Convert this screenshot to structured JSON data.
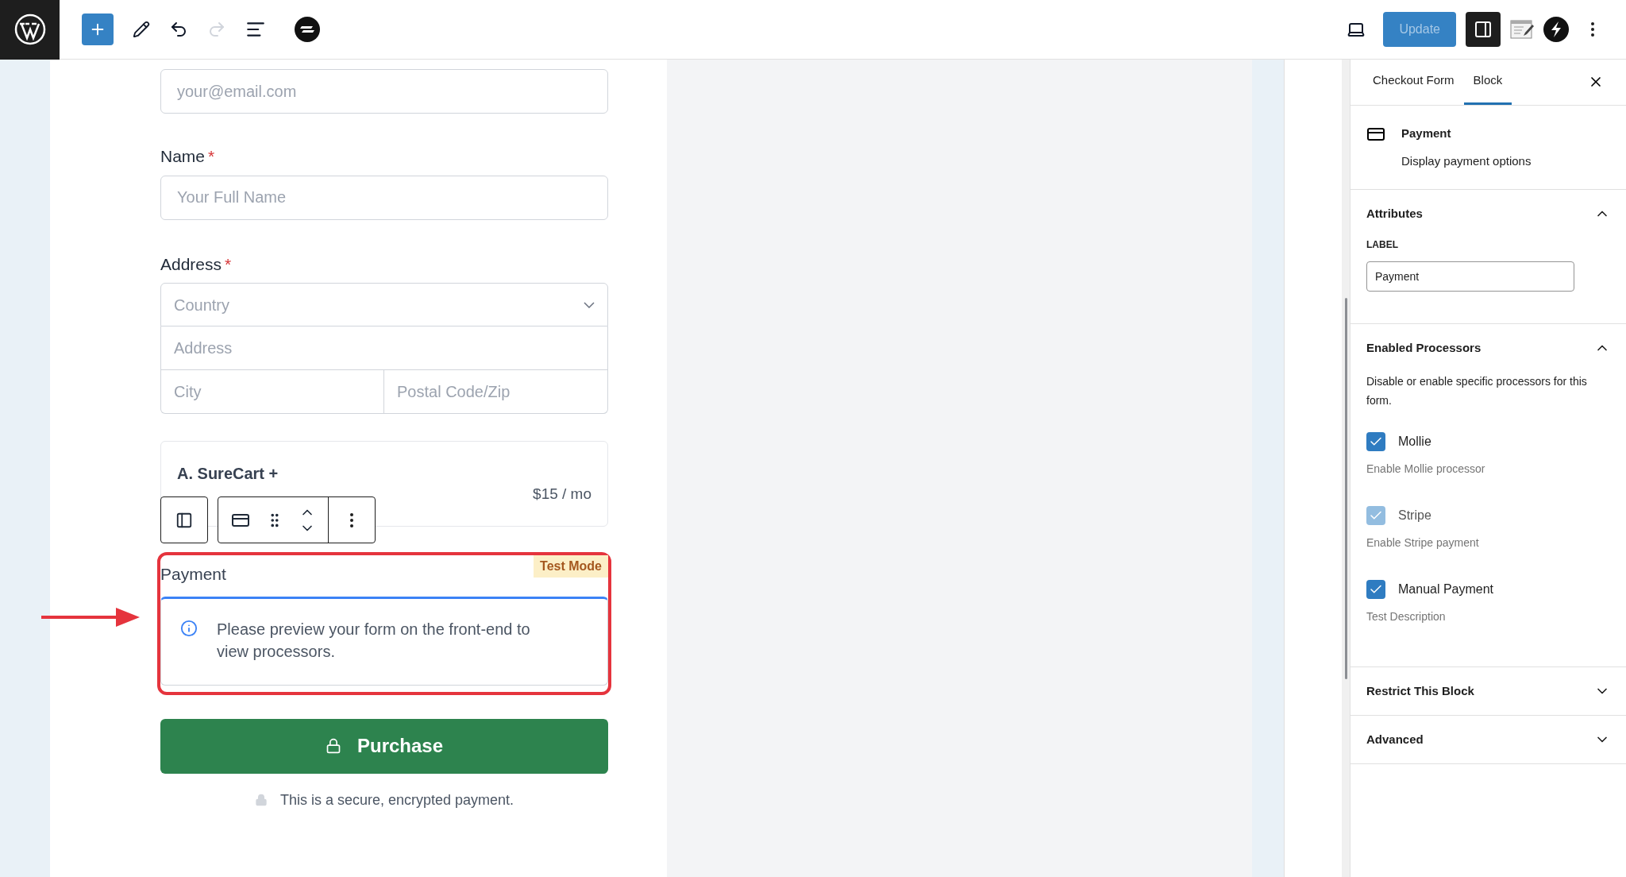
{
  "top_bar": {
    "left_tools": [
      {
        "kind": "add",
        "disabled": false
      },
      {
        "kind": "pencil",
        "disabled": false
      },
      {
        "kind": "undo",
        "disabled": false
      },
      {
        "kind": "redo",
        "disabled": true
      },
      {
        "kind": "list",
        "disabled": false
      },
      {
        "kind": "brand",
        "disabled": false
      }
    ],
    "update_button": {
      "label": "Update",
      "disabled": true
    },
    "right_tools": [
      {
        "kind": "laptop",
        "selected": false
      },
      {
        "kind": "sidebar",
        "selected": true
      },
      {
        "kind": "notepad",
        "selected": false
      },
      {
        "kind": "bolt",
        "selected": false
      },
      {
        "kind": "more",
        "selected": false
      }
    ]
  },
  "form": {
    "email": {
      "placeholder": "your@email.com"
    },
    "name": {
      "label": "Name",
      "required_mark": "*",
      "placeholder": "Your Full Name"
    },
    "address": {
      "label": "Address",
      "required_mark": "*",
      "country": "Country",
      "address_placeholder": "Address",
      "city_placeholder": "City",
      "postal_placeholder": "Postal Code/Zip"
    },
    "product": {
      "name": "A. SureCart +",
      "price": "$15 / mo"
    },
    "payment": {
      "label": "Payment",
      "badge": "Test Mode",
      "notice": "Please preview your form on the front-end to view processors."
    },
    "purchase_button": "Purchase",
    "secure_note": "This is a secure, encrypted payment."
  },
  "sidebar": {
    "tabs": [
      {
        "label": "Checkout Form",
        "selected": false
      },
      {
        "label": "Block",
        "selected": true
      }
    ],
    "block": {
      "title": "Payment",
      "description": "Display payment options"
    },
    "sections": [
      {
        "title": "Attributes",
        "expanded": true,
        "kind": "attributes",
        "field_label": "LABEL",
        "field_value": "Payment"
      },
      {
        "title": "Enabled Processors",
        "expanded": true,
        "kind": "processors",
        "description": "Disable or enable specific processors for this form.",
        "processors": [
          {
            "name": "Mollie",
            "description": "Enable Mollie processor",
            "checked": true,
            "disabled": false
          },
          {
            "name": "Stripe",
            "description": "Enable Stripe payment",
            "checked": true,
            "disabled": true
          },
          {
            "name": "Manual Payment",
            "description": "Test Description",
            "checked": true,
            "disabled": false
          }
        ]
      },
      {
        "title": "Restrict This Block",
        "expanded": false
      },
      {
        "title": "Advanced",
        "expanded": false
      }
    ]
  }
}
